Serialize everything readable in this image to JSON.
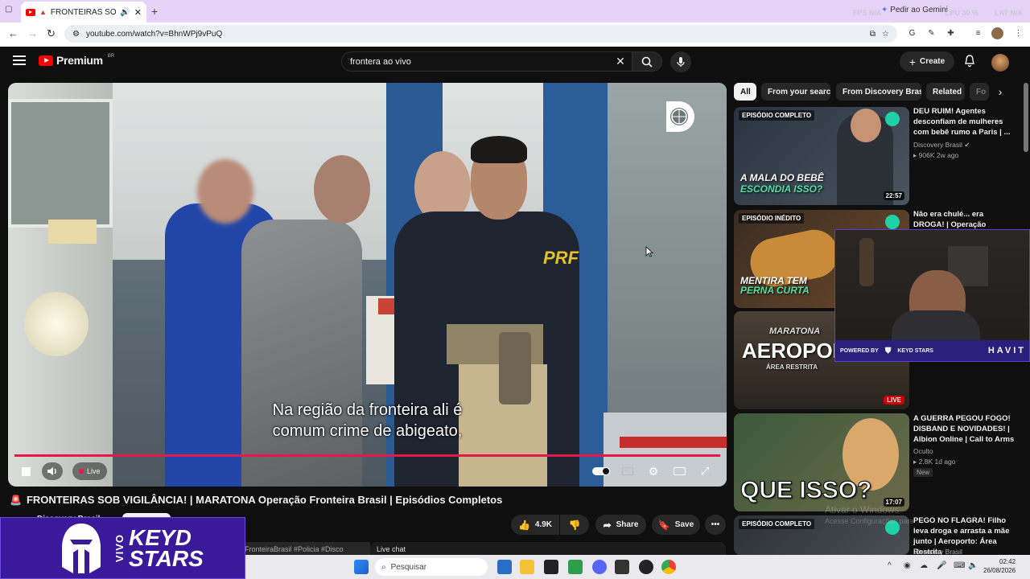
{
  "browser": {
    "tab_title": "FRONTEIRAS SOB VIGIL",
    "new_tab": "+",
    "gemini_label": "Pedir ao Gemini",
    "stats": [
      {
        "label": "FPS",
        "value": "N/A"
      },
      {
        "label": "CPU",
        "value": "30 %"
      },
      {
        "label": "LAT",
        "value": "N/A"
      }
    ],
    "url": "youtube.com/watch?v=BhnWPj9vPuQ"
  },
  "youtube": {
    "logo_text": "Premium",
    "logo_sup": "BR",
    "search_value": "frontera ao vivo",
    "create_label": "Create"
  },
  "video": {
    "subtitle_line1": "Na região da fronteira ali é",
    "subtitle_line2": "comum crime de abigeato,",
    "live_label": "Live",
    "progress": 1.0,
    "title": "FRONTEIRAS SOB VIGILÂNCIA! | MARATONA Operação Fronteira Brasil | Episódios Completos",
    "channel": "Discovery Brasil",
    "likes": "4.9K",
    "share_label": "Share",
    "save_label": "Save",
    "description_snippet": "FronteiraBrasil #Policia #Disco",
    "live_chat_label": "Live chat"
  },
  "overlay": {
    "vivo": "VIVO",
    "keyd_line1": "KEYD",
    "keyd_line2": "STARS",
    "powered_by": "POWERED BY",
    "powered_brand": "KEYD STARS",
    "havit": "HAVIT"
  },
  "chips": [
    "All",
    "From your search",
    "From Discovery Brasil",
    "Related",
    "Fo"
  ],
  "sidebar": [
    {
      "badge": "EPISÓDIO COMPLETO",
      "big_line1": "A MALA DO BEBÊ",
      "big_line2": "ESCONDIA ISSO?",
      "duration": "22:57",
      "title": "DEU RUIM! Agentes desconfiam de mulheres com bebê rumo a Paris | ...",
      "channel": "Discovery Brasil",
      "meta": "906K   2w ago"
    },
    {
      "badge": "EPISÓDIO INÉDITO",
      "big_line1": "MENTIRA TEM",
      "big_line2": "PERNA CURTA",
      "title": "Não era chulé... era DROGA! | Operação Fronteira Brasil"
    },
    {
      "big_line1": "MARATONA",
      "big_line2": "AEROPORTO",
      "big_line3": "ÁREA RESTRITA",
      "live": "LIVE"
    },
    {
      "big_line1": "QUE ISSO?",
      "duration": "17:07",
      "title": "A GUERRA PEGOU FOGO! DISBAND E NOVIDADES! | Albion Online | Call to Arms",
      "channel": "Oculto",
      "meta": "2.8K   1d ago",
      "new_badge": "New"
    },
    {
      "badge": "EPISÓDIO COMPLETO",
      "title": "PEGO NO FLAGRA! Filho leva droga e arrasta a mãe junto | Aeroporto: Área Restrita",
      "channel": "Discovery Brasil"
    }
  ],
  "watermark": {
    "line1": "Ativar o Windows",
    "line2": "Acesse Configurações para"
  },
  "taskbar": {
    "search_placeholder": "Pesquisar",
    "time": "02:42",
    "date": "26/08/2026"
  },
  "colors": {
    "progress": "#e5184a",
    "overlay_purple": "#3a1a9a",
    "youtube_red": "#ff0000"
  }
}
